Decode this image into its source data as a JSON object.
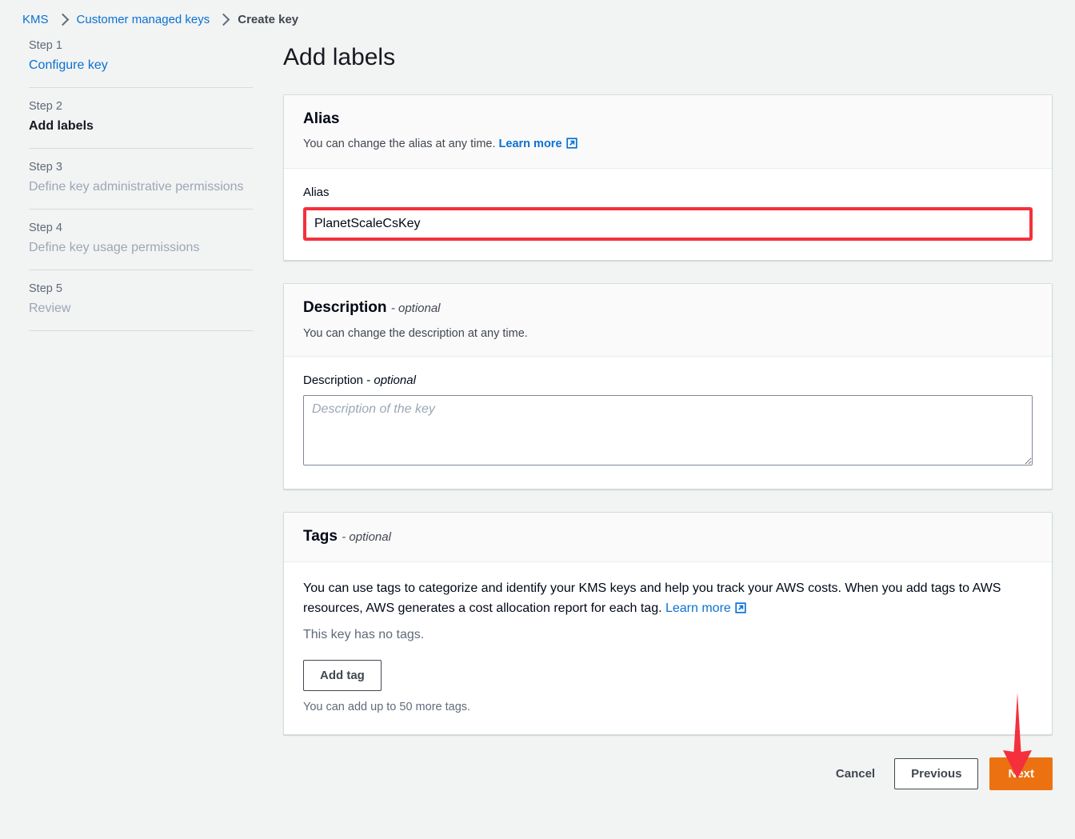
{
  "breadcrumb": {
    "items": [
      {
        "label": "KMS",
        "type": "link"
      },
      {
        "label": "Customer managed keys",
        "type": "link"
      },
      {
        "label": "Create key",
        "type": "current"
      }
    ]
  },
  "sidebar": {
    "steps": [
      {
        "num": "Step 1",
        "title": "Configure key",
        "state": "link"
      },
      {
        "num": "Step 2",
        "title": "Add labels",
        "state": "active"
      },
      {
        "num": "Step 3",
        "title": "Define key administrative permissions",
        "state": "muted"
      },
      {
        "num": "Step 4",
        "title": "Define key usage permissions",
        "state": "muted"
      },
      {
        "num": "Step 5",
        "title": "Review",
        "state": "muted"
      }
    ]
  },
  "main": {
    "page_title": "Add labels",
    "alias_panel": {
      "title": "Alias",
      "description": "You can change the alias at any time.",
      "learn_more": "Learn more",
      "field_label": "Alias",
      "field_value": "PlanetScaleCsKey",
      "highlight_color": "#f4303c"
    },
    "description_panel": {
      "title": "Description",
      "title_optional": "- optional",
      "description": "You can change the description at any time.",
      "field_label": "Description -",
      "field_label_optional": "optional",
      "field_placeholder": "Description of the key",
      "field_value": ""
    },
    "tags_panel": {
      "title": "Tags",
      "title_optional": "- optional",
      "body_text": "You can use tags to categorize and identify your KMS keys and help you track your AWS costs. When you add tags to AWS resources, AWS generates a cost allocation report for each tag.",
      "learn_more": "Learn more",
      "no_tags_text": "This key has no tags.",
      "add_tag_label": "Add tag",
      "remaining_hint": "You can add up to 50 more tags."
    }
  },
  "footer": {
    "cancel_label": "Cancel",
    "previous_label": "Previous",
    "next_label": "Next",
    "next_color": "#ec7211"
  },
  "annotations": {
    "arrow_target": "Next",
    "arrow_color": "#f4303c"
  }
}
